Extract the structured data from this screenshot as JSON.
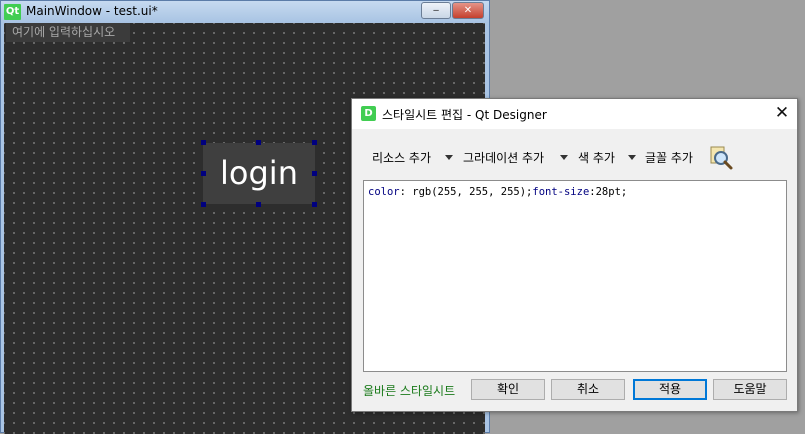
{
  "main_window": {
    "title": "MainWindow - test.ui*",
    "logo_text": "Qt",
    "minimize_glyph": "‒",
    "close_glyph": "✕",
    "line_edit_placeholder": "여기에 입력하십시오",
    "login_label": "login"
  },
  "dialog": {
    "title": "스타일시트 편집 - Qt Designer",
    "icon_text": "D",
    "close_glyph": "✕",
    "toolbar": {
      "add_resource": "리소스 추가",
      "add_gradient": "그라데이션 추가",
      "add_color": "색 추가",
      "add_font": "글꼴 추가"
    },
    "editor": {
      "prop1": "color",
      "val1": ": rgb(255, 255, 255);",
      "prop2": "font-size",
      "val2": ":28pt;"
    },
    "status": "올바른 스타일시트",
    "buttons": {
      "ok": "확인",
      "cancel": "취소",
      "apply": "적용",
      "help": "도움말"
    }
  },
  "colors": {
    "canvas_bg": "#2d2d2d",
    "status_valid": "#1a7a1a",
    "keyword": "#000080",
    "selection_handle": "#00007f"
  }
}
